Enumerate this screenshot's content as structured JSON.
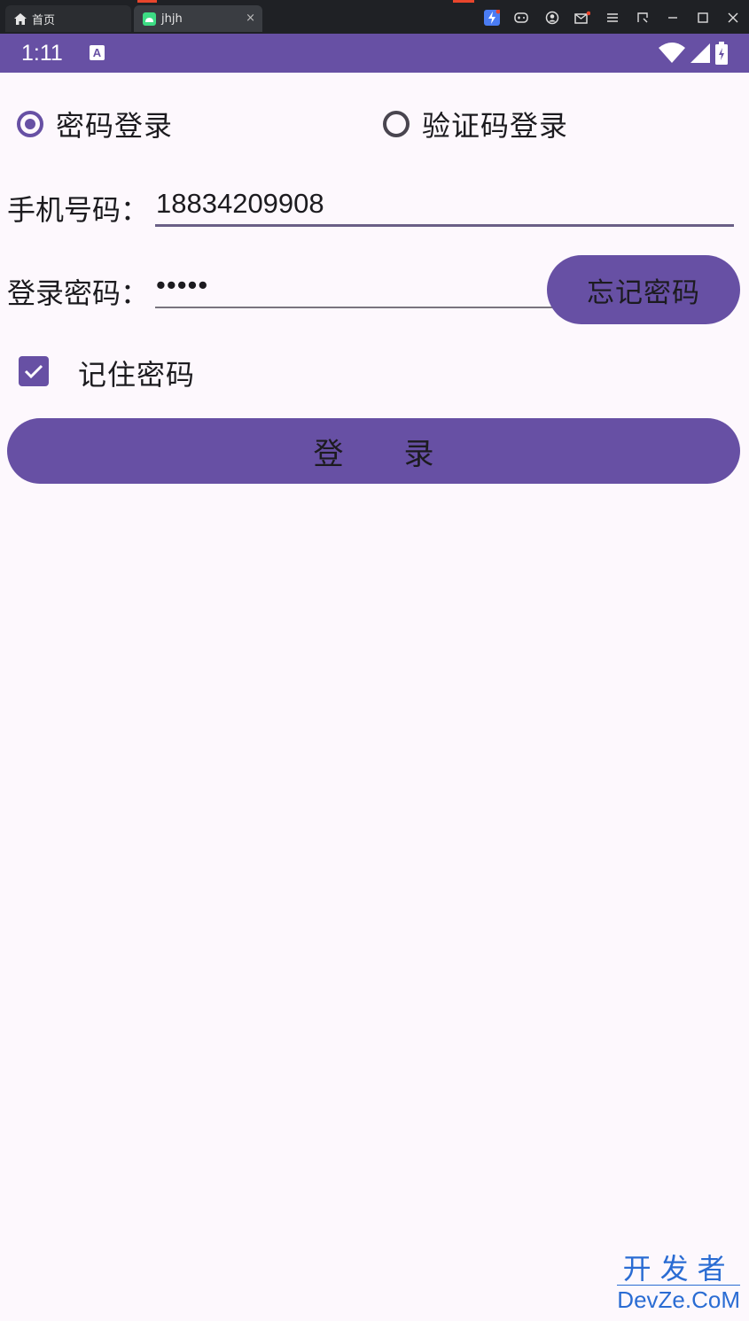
{
  "emulator": {
    "tabs": [
      {
        "label": "首页",
        "icon": "home-icon"
      },
      {
        "label": "jhjh",
        "icon": "android-icon"
      }
    ],
    "tab_close": "×",
    "toolbar_icons": [
      "bolt-icon",
      "gamepad-icon",
      "account-icon",
      "mail-icon",
      "menu-icon",
      "resize-icon",
      "minimize-icon",
      "maximize-icon",
      "close-icon"
    ]
  },
  "status_bar": {
    "time": "1:11",
    "badge": "A",
    "icons": [
      "wifi-icon",
      "signal-icon",
      "battery-icon"
    ]
  },
  "login_mode": {
    "options": [
      {
        "label": "密码登录",
        "selected": true
      },
      {
        "label": "验证码登录",
        "selected": false
      }
    ]
  },
  "phone": {
    "label": "手机号码：",
    "value": "18834209908"
  },
  "password": {
    "label": "登录密码：",
    "value": "•••••"
  },
  "forgot_button": "忘记密码",
  "remember": {
    "label": "记住密码",
    "checked": true
  },
  "login_button": "登　　录",
  "watermark": {
    "line1": "开发者",
    "line2": "DevZe.CoM"
  },
  "colors": {
    "accent": "#6750a4",
    "background": "#fdf8fd",
    "emulator_bar": "#1f2125"
  }
}
